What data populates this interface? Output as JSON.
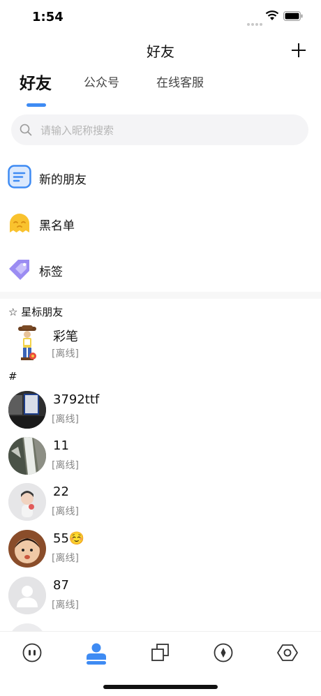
{
  "status_bar": {
    "time": "1:54"
  },
  "header": {
    "title": "好友"
  },
  "tabs": [
    {
      "label": "好友"
    },
    {
      "label": "公众号"
    },
    {
      "label": "在线客服"
    }
  ],
  "search": {
    "placeholder": "请输入昵称搜索"
  },
  "menu": [
    {
      "label": "新的朋友",
      "icon": "new-friends-icon"
    },
    {
      "label": "黑名单",
      "icon": "blacklist-ghost-icon"
    },
    {
      "label": "标签",
      "icon": "tag-icon"
    }
  ],
  "starred": {
    "header": "☆ 星标朋友",
    "contacts": [
      {
        "name": "彩笔",
        "status": "[离线]"
      }
    ]
  },
  "others": {
    "header": "#",
    "contacts": [
      {
        "name": "3792ttf",
        "status": "[离线]"
      },
      {
        "name": "11",
        "status": "[离线]"
      },
      {
        "name": "22",
        "status": "[离线]"
      },
      {
        "name": "55☺️",
        "status": "[离线]"
      },
      {
        "name": "87",
        "status": "[离线]"
      }
    ]
  },
  "tab_bar": [
    {
      "icon": "chat-icon"
    },
    {
      "icon": "contacts-icon",
      "active": true
    },
    {
      "icon": "layers-icon"
    },
    {
      "icon": "compass-icon"
    },
    {
      "icon": "settings-hex-icon"
    }
  ],
  "colors": {
    "accent": "#3e8bf3",
    "status_text": "#888888"
  }
}
